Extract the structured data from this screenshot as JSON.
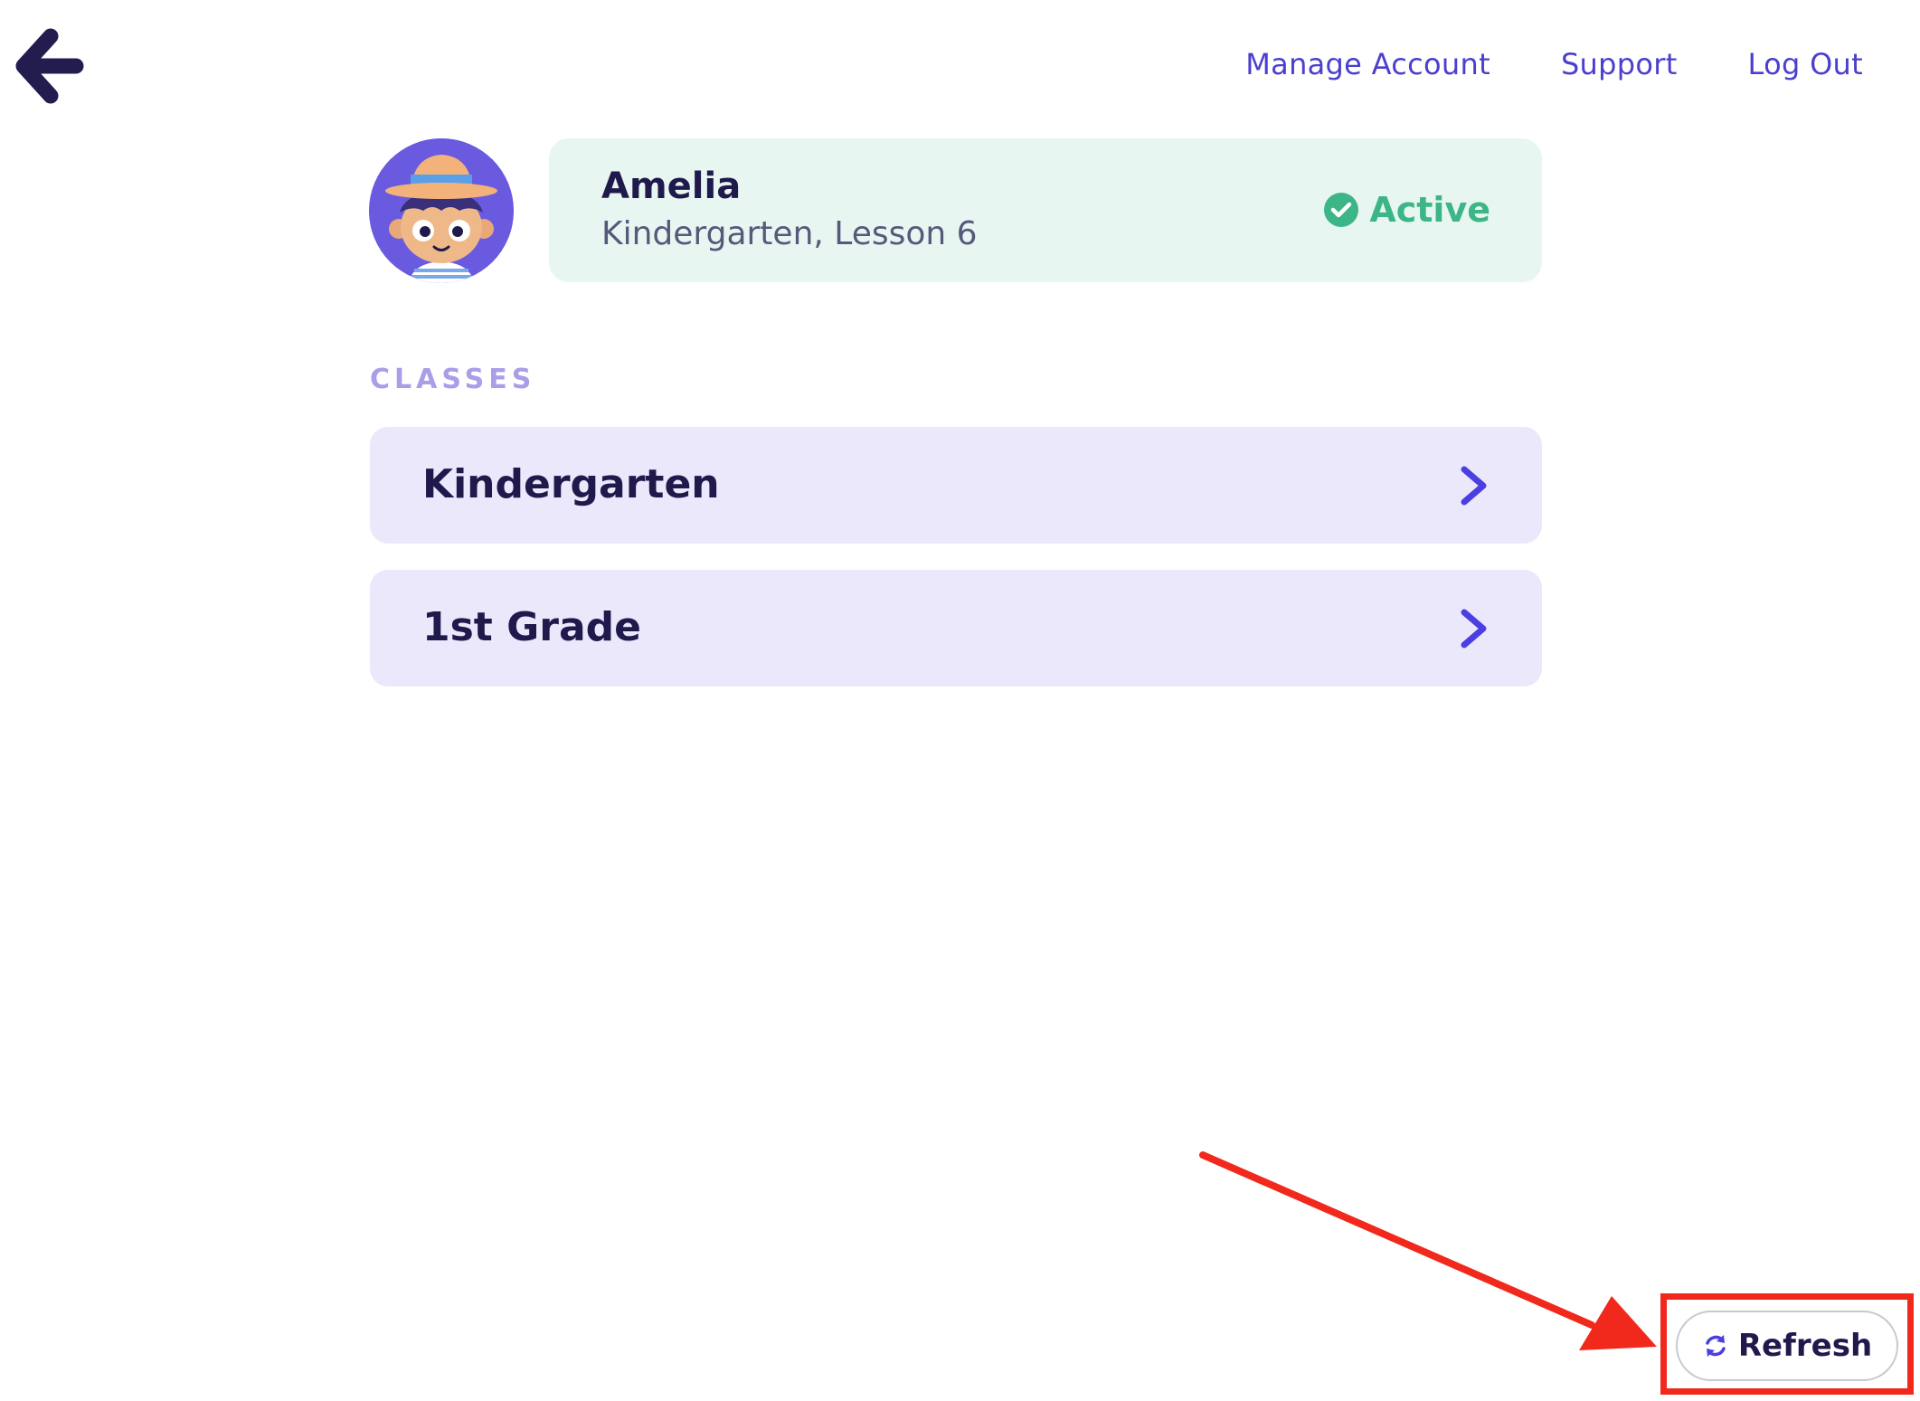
{
  "nav": {
    "back_icon": "arrow-left-icon",
    "links": [
      {
        "label": "Manage Account"
      },
      {
        "label": "Support"
      },
      {
        "label": "Log Out"
      }
    ]
  },
  "profile": {
    "avatar_icon": "child-avatar-icon",
    "name": "Amelia",
    "subtitle": "Kindergarten, Lesson 6",
    "status_label": "Active",
    "status_icon": "check-circle-icon",
    "status_color": "#3cb587"
  },
  "classes": {
    "heading": "CLASSES",
    "items": [
      {
        "label": "Kindergarten",
        "icon": "chevron-right-icon"
      },
      {
        "label": "1st Grade",
        "icon": "chevron-right-icon"
      }
    ]
  },
  "refresh": {
    "label": "Refresh",
    "icon": "refresh-icon"
  },
  "annotation": {
    "color": "#f0291c"
  },
  "colors": {
    "accent": "#4a3fcf",
    "dark_text": "#1f1a4b",
    "card_bg": "#ebe8fb",
    "profile_bg": "#e8f6f1"
  }
}
